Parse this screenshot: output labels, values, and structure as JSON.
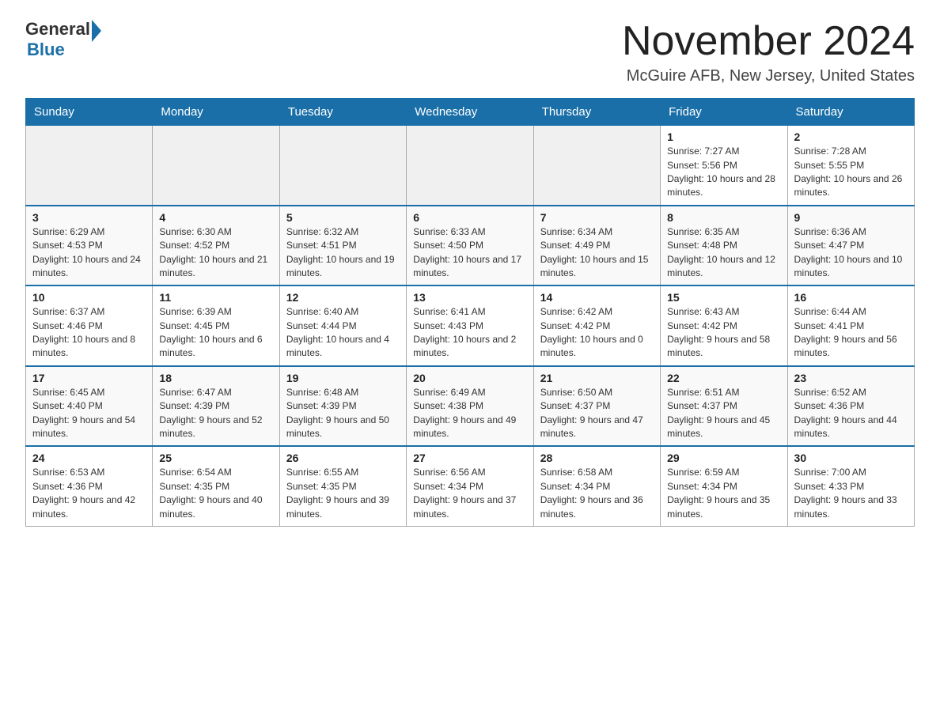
{
  "header": {
    "logo_general": "General",
    "logo_blue": "Blue",
    "month_title": "November 2024",
    "location": "McGuire AFB, New Jersey, United States"
  },
  "weekdays": [
    "Sunday",
    "Monday",
    "Tuesday",
    "Wednesday",
    "Thursday",
    "Friday",
    "Saturday"
  ],
  "weeks": [
    [
      {
        "day": "",
        "info": ""
      },
      {
        "day": "",
        "info": ""
      },
      {
        "day": "",
        "info": ""
      },
      {
        "day": "",
        "info": ""
      },
      {
        "day": "",
        "info": ""
      },
      {
        "day": "1",
        "info": "Sunrise: 7:27 AM\nSunset: 5:56 PM\nDaylight: 10 hours and 28 minutes."
      },
      {
        "day": "2",
        "info": "Sunrise: 7:28 AM\nSunset: 5:55 PM\nDaylight: 10 hours and 26 minutes."
      }
    ],
    [
      {
        "day": "3",
        "info": "Sunrise: 6:29 AM\nSunset: 4:53 PM\nDaylight: 10 hours and 24 minutes."
      },
      {
        "day": "4",
        "info": "Sunrise: 6:30 AM\nSunset: 4:52 PM\nDaylight: 10 hours and 21 minutes."
      },
      {
        "day": "5",
        "info": "Sunrise: 6:32 AM\nSunset: 4:51 PM\nDaylight: 10 hours and 19 minutes."
      },
      {
        "day": "6",
        "info": "Sunrise: 6:33 AM\nSunset: 4:50 PM\nDaylight: 10 hours and 17 minutes."
      },
      {
        "day": "7",
        "info": "Sunrise: 6:34 AM\nSunset: 4:49 PM\nDaylight: 10 hours and 15 minutes."
      },
      {
        "day": "8",
        "info": "Sunrise: 6:35 AM\nSunset: 4:48 PM\nDaylight: 10 hours and 12 minutes."
      },
      {
        "day": "9",
        "info": "Sunrise: 6:36 AM\nSunset: 4:47 PM\nDaylight: 10 hours and 10 minutes."
      }
    ],
    [
      {
        "day": "10",
        "info": "Sunrise: 6:37 AM\nSunset: 4:46 PM\nDaylight: 10 hours and 8 minutes."
      },
      {
        "day": "11",
        "info": "Sunrise: 6:39 AM\nSunset: 4:45 PM\nDaylight: 10 hours and 6 minutes."
      },
      {
        "day": "12",
        "info": "Sunrise: 6:40 AM\nSunset: 4:44 PM\nDaylight: 10 hours and 4 minutes."
      },
      {
        "day": "13",
        "info": "Sunrise: 6:41 AM\nSunset: 4:43 PM\nDaylight: 10 hours and 2 minutes."
      },
      {
        "day": "14",
        "info": "Sunrise: 6:42 AM\nSunset: 4:42 PM\nDaylight: 10 hours and 0 minutes."
      },
      {
        "day": "15",
        "info": "Sunrise: 6:43 AM\nSunset: 4:42 PM\nDaylight: 9 hours and 58 minutes."
      },
      {
        "day": "16",
        "info": "Sunrise: 6:44 AM\nSunset: 4:41 PM\nDaylight: 9 hours and 56 minutes."
      }
    ],
    [
      {
        "day": "17",
        "info": "Sunrise: 6:45 AM\nSunset: 4:40 PM\nDaylight: 9 hours and 54 minutes."
      },
      {
        "day": "18",
        "info": "Sunrise: 6:47 AM\nSunset: 4:39 PM\nDaylight: 9 hours and 52 minutes."
      },
      {
        "day": "19",
        "info": "Sunrise: 6:48 AM\nSunset: 4:39 PM\nDaylight: 9 hours and 50 minutes."
      },
      {
        "day": "20",
        "info": "Sunrise: 6:49 AM\nSunset: 4:38 PM\nDaylight: 9 hours and 49 minutes."
      },
      {
        "day": "21",
        "info": "Sunrise: 6:50 AM\nSunset: 4:37 PM\nDaylight: 9 hours and 47 minutes."
      },
      {
        "day": "22",
        "info": "Sunrise: 6:51 AM\nSunset: 4:37 PM\nDaylight: 9 hours and 45 minutes."
      },
      {
        "day": "23",
        "info": "Sunrise: 6:52 AM\nSunset: 4:36 PM\nDaylight: 9 hours and 44 minutes."
      }
    ],
    [
      {
        "day": "24",
        "info": "Sunrise: 6:53 AM\nSunset: 4:36 PM\nDaylight: 9 hours and 42 minutes."
      },
      {
        "day": "25",
        "info": "Sunrise: 6:54 AM\nSunset: 4:35 PM\nDaylight: 9 hours and 40 minutes."
      },
      {
        "day": "26",
        "info": "Sunrise: 6:55 AM\nSunset: 4:35 PM\nDaylight: 9 hours and 39 minutes."
      },
      {
        "day": "27",
        "info": "Sunrise: 6:56 AM\nSunset: 4:34 PM\nDaylight: 9 hours and 37 minutes."
      },
      {
        "day": "28",
        "info": "Sunrise: 6:58 AM\nSunset: 4:34 PM\nDaylight: 9 hours and 36 minutes."
      },
      {
        "day": "29",
        "info": "Sunrise: 6:59 AM\nSunset: 4:34 PM\nDaylight: 9 hours and 35 minutes."
      },
      {
        "day": "30",
        "info": "Sunrise: 7:00 AM\nSunset: 4:33 PM\nDaylight: 9 hours and 33 minutes."
      }
    ]
  ]
}
